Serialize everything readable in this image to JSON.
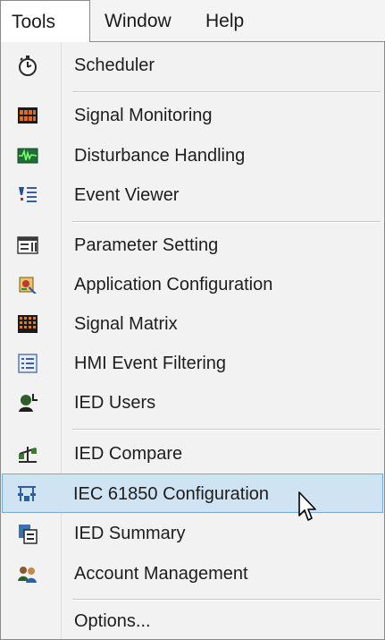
{
  "menubar": {
    "tools": "Tools",
    "window": "Window",
    "help": "Help"
  },
  "menu": {
    "items": [
      {
        "label": "Scheduler",
        "icon": "stopwatch-icon"
      },
      {
        "label": "Signal Monitoring",
        "icon": "signal-display-icon"
      },
      {
        "label": "Disturbance Handling",
        "icon": "waveform-icon"
      },
      {
        "label": "Event Viewer",
        "icon": "event-list-icon"
      },
      {
        "label": "Parameter Setting",
        "icon": "parameter-list-icon"
      },
      {
        "label": "Application Configuration",
        "icon": "app-config-icon"
      },
      {
        "label": "Signal Matrix",
        "icon": "grid-matrix-icon"
      },
      {
        "label": "HMI Event Filtering",
        "icon": "filter-list-icon"
      },
      {
        "label": "IED Users",
        "icon": "users-icon"
      },
      {
        "label": "IED Compare",
        "icon": "compare-icon"
      },
      {
        "label": "IEC 61850 Configuration",
        "icon": "network-config-icon"
      },
      {
        "label": "IED Summary",
        "icon": "summary-icon"
      },
      {
        "label": "Account Management",
        "icon": "accounts-icon"
      },
      {
        "label": "Options...",
        "icon": ""
      }
    ],
    "highlighted": "IEC 61850 Configuration"
  },
  "colors": {
    "highlight_bg": "#cfe3f3",
    "highlight_border": "#7aa7d6",
    "menu_bg": "#f2f2f2"
  }
}
